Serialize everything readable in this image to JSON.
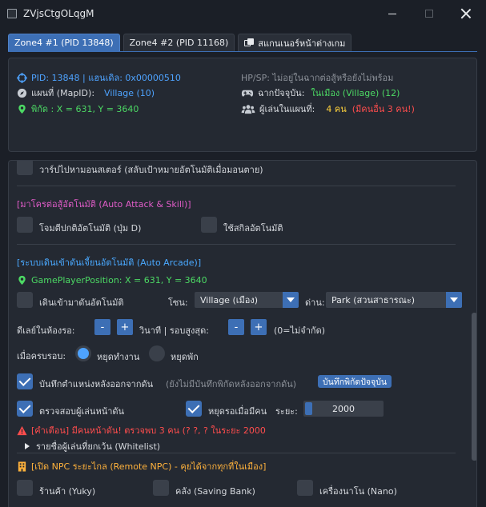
{
  "window": {
    "title": "ZVjsCtgOLqgM"
  },
  "tabs": [
    {
      "label": "Zone4 #1 (PID 13848)",
      "active": true
    },
    {
      "label": "Zone4 #2 (PID 11168)",
      "active": false
    },
    {
      "label": "สแกนเนอร์หน้าต่างเกม",
      "active": false,
      "icon": "windows-icon"
    }
  ],
  "info": {
    "pid_line": "PID: 13848 | แฮนเดิล: 0x00000510",
    "map_label": "แผนที่ (MapID):",
    "map_value": "Village (10)",
    "coords": "พิกัด : X = 631, Y = 3640",
    "hpsp": "HP/SP: ไม่อยู่ในฉากต่อสู้หรือยังไม่พร้อม",
    "scene_label": "ฉากปัจจุบัน:",
    "scene_value": "ในเมือง (Village) (12)",
    "players_label": "ผู้เล่นในแผนที่:",
    "players_value": "4 คน",
    "players_extra": "(มีคนอื่น 3 คน!)"
  },
  "panel": {
    "warp_monster": "วาร์ปไปหามอนสเตอร์ (สลับเป้าหมายอัตโนมัติเมื่อมอนตาย)",
    "macro_header": "[มาโครต่อสู้อัตโนมัติ (Auto Attack & Skill)]",
    "auto_attack": "โจมตีปกติอัตโนมัติ (ปุ่ม D)",
    "auto_skill": "ใช้สกิลอัตโนมัติ",
    "arcade_header": "[ระบบเดินเข้าดันเจี้ยนอัตโนมัติ (Auto Arcade)]",
    "game_pos": "GamePlayerPosition: X = 631, Y = 3640",
    "auto_walk": "เดินเข้ามาดันอัตโนมัติ",
    "zone_label": "โซน:",
    "zone_value": "Village (เมือง)",
    "dungeon_label": "ด่าน:",
    "dungeon_value": "Park (สวนสาธารณะ)",
    "delay_label": "ดีเลย์ในห้องรอ:",
    "seconds_label": "วินาที | รอบสูงสุด:",
    "max_note": "(0=ไม่จำกัด)",
    "minus": "-",
    "plus": "+",
    "on_complete_label": "เมื่อครบรอบ:",
    "stop_work": "หยุดทำงาน",
    "stop_rest": "หยุดพัก",
    "save_pos": "บันทึกตำแหน่งหลังออกจากดัน",
    "save_pos_note": "(ยังไม่มีบันทึกพิกัดหลังออกจากดัน)",
    "save_now_btn": "บันทึกพิกัดปัจจุบัน",
    "check_players": "ตรวจสอบผู้เล่นหน้าดัน",
    "wait_no_one": "หยุดรอเมื่อมีคน",
    "distance_label": "ระยะ:",
    "distance_value": "2000",
    "distance_fraction": 0.2,
    "warning": "[คำเตือน] มีคนหน้าดัน! ตรวจพบ 3 คน (? ?, ? ในระยะ 2000",
    "whitelist": "รายชื่อผู้เล่นที่ยกเว้น (Whitelist)",
    "npc_header": "[เปิด NPC ระยะไกล (Remote NPC) - คุยได้จากทุกที่ในเมือง]",
    "npc_shop": "ร้านค้า (Yuky)",
    "npc_bank": "คลัง (Saving Bank)",
    "npc_nano": "เครื่องนาโน (Nano)"
  },
  "states": {
    "warp_monster": false,
    "auto_attack": false,
    "auto_skill": false,
    "auto_walk": false,
    "on_complete": "stop_work",
    "save_pos": true,
    "check_players": true,
    "wait_no_one": true,
    "npc_shop": false,
    "npc_bank": false,
    "npc_nano": false
  },
  "colors": {
    "accent": "#3d6fb5",
    "info_blue": "#4ea3ff",
    "green": "#4cd964",
    "yellow": "#ffd23c",
    "red": "#ff4d4d",
    "pink": "#e05cc8"
  }
}
